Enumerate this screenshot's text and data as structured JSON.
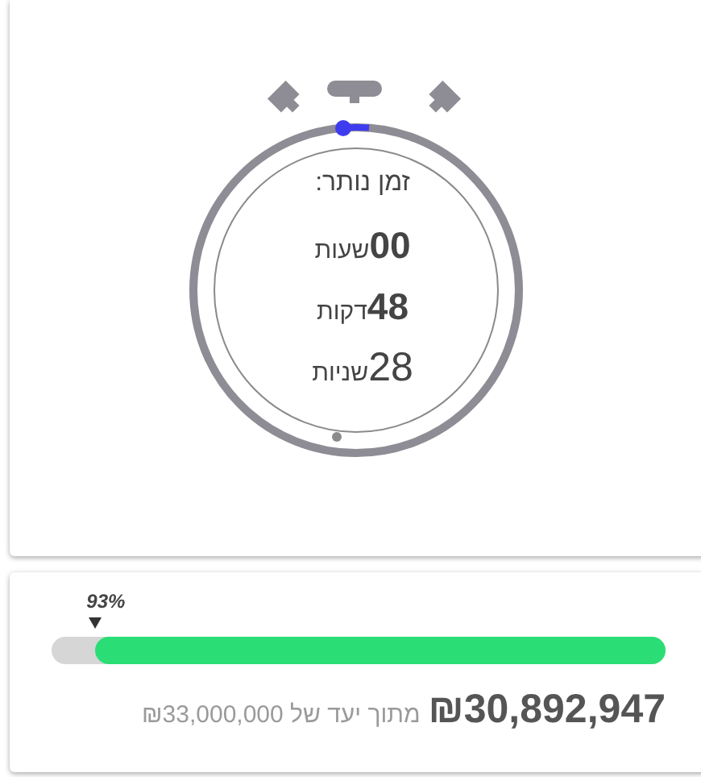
{
  "timer": {
    "title": "זמן נותר:",
    "units": [
      {
        "value": "00",
        "label": "שעות",
        "bold": true
      },
      {
        "value": "48",
        "label": "דקות",
        "bold": true
      },
      {
        "value": "28",
        "label": "שניות",
        "bold": false
      }
    ]
  },
  "goal": {
    "percent_label": "93%",
    "level": 0.93,
    "raised": "₪30,892,947",
    "target_text": "מתוך יעד של ₪33,000,000"
  }
}
